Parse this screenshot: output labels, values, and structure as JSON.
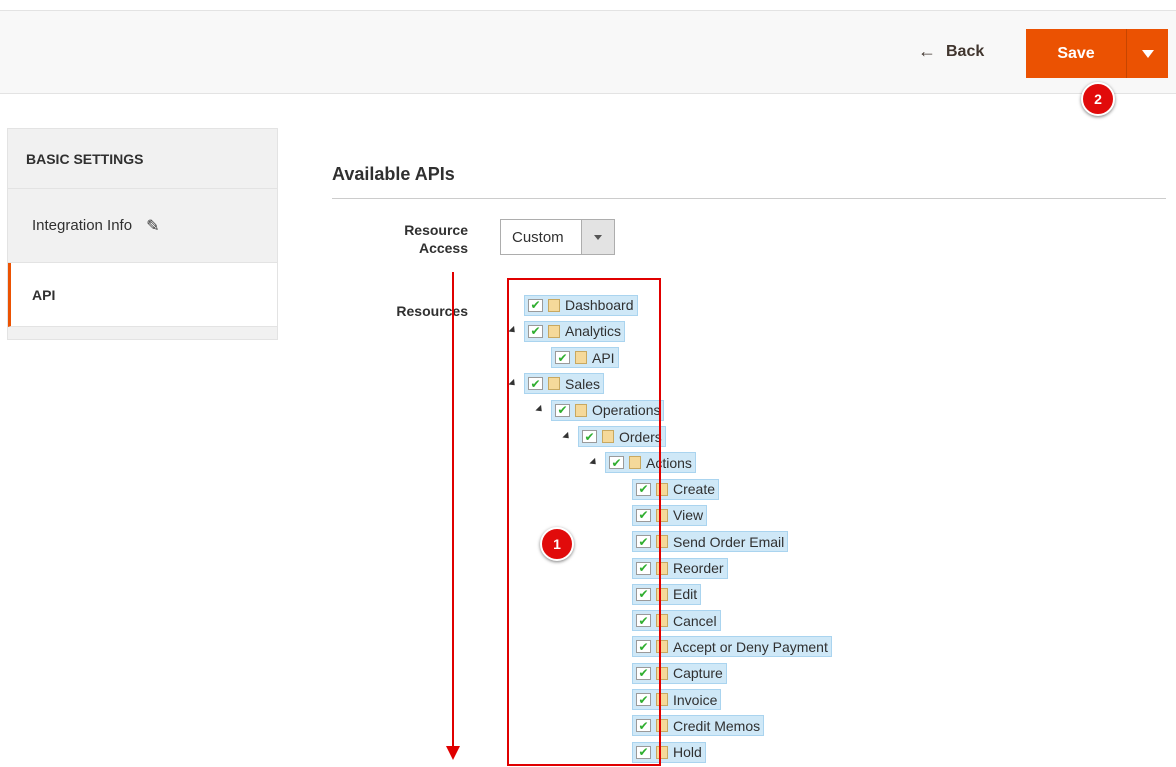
{
  "header": {
    "back_label": "Back",
    "save_label": "Save"
  },
  "callouts": [
    "1",
    "2"
  ],
  "sidebar": {
    "title": "BASIC SETTINGS",
    "items": [
      {
        "label": "Integration Info",
        "icon": "pencil-icon"
      },
      {
        "label": "API",
        "active": true
      }
    ]
  },
  "main": {
    "section_title": "Available APIs",
    "resource_access_label": "Resource Access",
    "resource_access_value": "Custom",
    "resources_label": "Resources",
    "tree": [
      {
        "label": "Dashboard",
        "depth": 0,
        "expander": false,
        "checked": true
      },
      {
        "label": "Analytics",
        "depth": 0,
        "expander": true,
        "checked": true
      },
      {
        "label": "API",
        "depth": 1,
        "expander": false,
        "checked": true
      },
      {
        "label": "Sales",
        "depth": 0,
        "expander": true,
        "checked": true
      },
      {
        "label": "Operations",
        "depth": 1,
        "expander": true,
        "checked": true
      },
      {
        "label": "Orders",
        "depth": 2,
        "expander": true,
        "checked": true
      },
      {
        "label": "Actions",
        "depth": 3,
        "expander": true,
        "checked": true
      },
      {
        "label": "Create",
        "depth": 4,
        "expander": false,
        "checked": true
      },
      {
        "label": "View",
        "depth": 4,
        "expander": false,
        "checked": true
      },
      {
        "label": "Send Order Email",
        "depth": 4,
        "expander": false,
        "checked": true
      },
      {
        "label": "Reorder",
        "depth": 4,
        "expander": false,
        "checked": true
      },
      {
        "label": "Edit",
        "depth": 4,
        "expander": false,
        "checked": true
      },
      {
        "label": "Cancel",
        "depth": 4,
        "expander": false,
        "checked": true
      },
      {
        "label": "Accept or Deny Payment",
        "depth": 4,
        "expander": false,
        "checked": true
      },
      {
        "label": "Capture",
        "depth": 4,
        "expander": false,
        "checked": true
      },
      {
        "label": "Invoice",
        "depth": 4,
        "expander": false,
        "checked": true
      },
      {
        "label": "Credit Memos",
        "depth": 4,
        "expander": false,
        "checked": true
      },
      {
        "label": "Hold",
        "depth": 4,
        "expander": false,
        "checked": true
      }
    ]
  },
  "colors": {
    "accent": "#eb5202",
    "annotation": "#e00000",
    "node_highlight": "#cfe8f7"
  }
}
